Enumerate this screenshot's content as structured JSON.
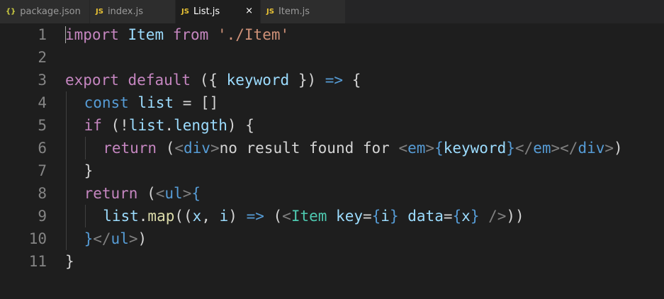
{
  "tabs": [
    {
      "icon": "{}",
      "label": "package.json",
      "active": false
    },
    {
      "icon": "JS",
      "label": "index.js",
      "active": false
    },
    {
      "icon": "JS",
      "label": "List.js",
      "active": true,
      "close": "×"
    },
    {
      "icon": "JS",
      "label": "Item.js",
      "active": false
    }
  ],
  "colors": {
    "keyword": "#c586c0",
    "storage": "#569cd6",
    "variable": "#9cdcfe",
    "component": "#4ec9b0",
    "string": "#ce9178",
    "operator": "#569cd6",
    "plain": "#d4d4d4",
    "function": "#dcdcaa",
    "tag_bracket": "#808080"
  },
  "lines": [
    {
      "n": "1",
      "indent": 0,
      "tokens": [
        [
          "import",
          "keyword"
        ],
        [
          " ",
          "plain"
        ],
        [
          "Item",
          "variable"
        ],
        [
          " ",
          "plain"
        ],
        [
          "from",
          "keyword"
        ],
        [
          " ",
          "plain"
        ],
        [
          "'./Item'",
          "string"
        ]
      ]
    },
    {
      "n": "2",
      "indent": 0,
      "tokens": []
    },
    {
      "n": "3",
      "indent": 0,
      "tokens": [
        [
          "export",
          "keyword"
        ],
        [
          " ",
          "plain"
        ],
        [
          "default",
          "keyword"
        ],
        [
          " ",
          "plain"
        ],
        [
          "({",
          "plain"
        ],
        [
          " ",
          "plain"
        ],
        [
          "keyword",
          "variable"
        ],
        [
          " ",
          "plain"
        ],
        [
          "})",
          "plain"
        ],
        [
          " ",
          "plain"
        ],
        [
          "=>",
          "operator"
        ],
        [
          " ",
          "plain"
        ],
        [
          "{",
          "plain"
        ]
      ]
    },
    {
      "n": "4",
      "indent": 1,
      "tokens": [
        [
          "const",
          "storage"
        ],
        [
          " ",
          "plain"
        ],
        [
          "list",
          "variable"
        ],
        [
          " = []",
          "plain"
        ]
      ]
    },
    {
      "n": "5",
      "indent": 1,
      "tokens": [
        [
          "if",
          "keyword"
        ],
        [
          " (!",
          "plain"
        ],
        [
          "list",
          "variable"
        ],
        [
          ".",
          "plain"
        ],
        [
          "length",
          "variable"
        ],
        [
          ") {",
          "plain"
        ]
      ]
    },
    {
      "n": "6",
      "indent": 2,
      "tokens": [
        [
          "return",
          "keyword"
        ],
        [
          " (",
          "plain"
        ],
        [
          "<",
          "tag_bracket"
        ],
        [
          "div",
          "storage"
        ],
        [
          ">",
          "tag_bracket"
        ],
        [
          "no result found for ",
          "plain"
        ],
        [
          "<",
          "tag_bracket"
        ],
        [
          "em",
          "storage"
        ],
        [
          ">",
          "tag_bracket"
        ],
        [
          "{",
          "storage"
        ],
        [
          "keyword",
          "variable"
        ],
        [
          "}",
          "storage"
        ],
        [
          "</",
          "tag_bracket"
        ],
        [
          "em",
          "storage"
        ],
        [
          "></",
          "tag_bracket"
        ],
        [
          "div",
          "storage"
        ],
        [
          ">",
          "tag_bracket"
        ],
        [
          ")",
          "plain"
        ]
      ]
    },
    {
      "n": "7",
      "indent": 1,
      "tokens": [
        [
          "}",
          "plain"
        ]
      ]
    },
    {
      "n": "8",
      "indent": 1,
      "tokens": [
        [
          "return",
          "keyword"
        ],
        [
          " (",
          "plain"
        ],
        [
          "<",
          "tag_bracket"
        ],
        [
          "ul",
          "storage"
        ],
        [
          ">",
          "tag_bracket"
        ],
        [
          "{",
          "storage"
        ]
      ]
    },
    {
      "n": "9",
      "indent": 2,
      "tokens": [
        [
          "list",
          "variable"
        ],
        [
          ".",
          "plain"
        ],
        [
          "map",
          "function"
        ],
        [
          "((",
          "plain"
        ],
        [
          "x",
          "variable"
        ],
        [
          ", ",
          "plain"
        ],
        [
          "i",
          "variable"
        ],
        [
          ") ",
          "plain"
        ],
        [
          "=>",
          "operator"
        ],
        [
          " (",
          "plain"
        ],
        [
          "<",
          "tag_bracket"
        ],
        [
          "Item",
          "component"
        ],
        [
          " ",
          "plain"
        ],
        [
          "key",
          "variable"
        ],
        [
          "=",
          "plain"
        ],
        [
          "{",
          "storage"
        ],
        [
          "i",
          "variable"
        ],
        [
          "}",
          "storage"
        ],
        [
          " ",
          "plain"
        ],
        [
          "data",
          "variable"
        ],
        [
          "=",
          "plain"
        ],
        [
          "{",
          "storage"
        ],
        [
          "x",
          "variable"
        ],
        [
          "}",
          "storage"
        ],
        [
          " />",
          "tag_bracket"
        ],
        [
          "))",
          "plain"
        ]
      ]
    },
    {
      "n": "10",
      "indent": 1,
      "tokens": [
        [
          "}",
          "storage"
        ],
        [
          "</",
          "tag_bracket"
        ],
        [
          "ul",
          "storage"
        ],
        [
          ">",
          "tag_bracket"
        ],
        [
          ")",
          "plain"
        ]
      ]
    },
    {
      "n": "11",
      "indent": 0,
      "tokens": [
        [
          "}",
          "plain"
        ]
      ]
    }
  ]
}
